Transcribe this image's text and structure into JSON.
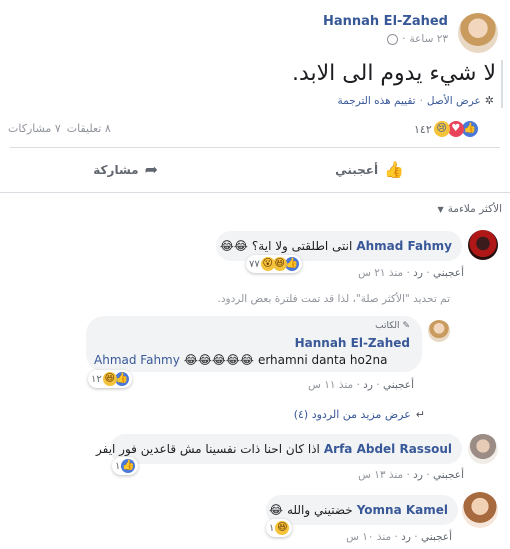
{
  "post": {
    "author": "Hannah El-Zahed",
    "time": "٢٣ ساعة",
    "text": "لا شيء يدوم الى الابد.",
    "see_original": "عرض الأصل",
    "rate_translation": "تقييم هذه الترجمة",
    "shares": "٧ مشاركات",
    "comments": "٨ تعليقات",
    "reaction_count": "١٤٢",
    "actions": {
      "like": "أعجبني",
      "share": "مشاركة"
    }
  },
  "sort": {
    "label": "الأكثر ملاءمة"
  },
  "notice": "تم تحديد \"الأكثر صلة\"، لذا قد تمت فلترة بعض الردود.",
  "comments": [
    {
      "author": "Ahmad Fahmy",
      "text": "انتى اطلقتى ولا اية؟",
      "like": "أعجبني",
      "reply": "رد",
      "time": "منذ ٢١ س",
      "reaction_count": "٧٧"
    },
    {
      "badge": "الكاتب",
      "author": "Hannah El-Zahed",
      "mention": "Ahmad Fahmy",
      "text": "erhamni danta ho2na",
      "like": "أعجبني",
      "reply": "رد",
      "time": "منذ ١١ س",
      "reaction_count": "١٢"
    },
    {
      "more_replies": "عرض مزيد من الردود (٤)"
    },
    {
      "author": "Arfa Abdel Rassoul",
      "text": "اذا كان احنا ذات نفسينا مش قاعدين فور ايفر",
      "like": "أعجبني",
      "reply": "رد",
      "time": "منذ ١٣ س",
      "reaction_count": "١"
    },
    {
      "author": "Yomna Kamel",
      "text": "خضتيني والله",
      "like": "أعجبني",
      "reply": "رد",
      "time": "منذ ١٠ س",
      "reaction_count": "١"
    }
  ],
  "colors": {
    "link": "#385898",
    "accent": "#4267b2",
    "bubble": "#f2f3f5"
  }
}
